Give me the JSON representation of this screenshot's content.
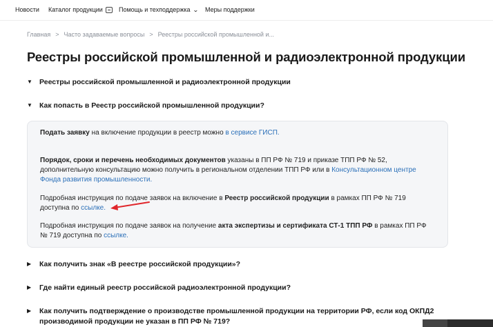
{
  "nav": {
    "news": "Новости",
    "catalog": "Каталог продукции",
    "help": "Помощь и техподдержка",
    "support": "Меры поддержки"
  },
  "breadcrumb": [
    "Главная",
    "Часто задаваемые вопросы",
    "Реестры российской промышленной и..."
  ],
  "page_title": "Реестры российской промышленной и радиоэлектронной продукции",
  "accordion": [
    {
      "q": "Реестры российской промышленной и радиоэлектронной продукции",
      "state": "open"
    },
    {
      "q": "Как попасть в Реестр российской промышленной продукции?",
      "state": "open"
    },
    {
      "q": "Как получить знак «В реестре российской продукции»?",
      "state": "closed"
    },
    {
      "q": "Где найти единый реестр российской радиоэлектронной продукции?",
      "state": "closed"
    },
    {
      "q": "Как получить подтверждение о производстве промышленной продукции на территории РФ, если код ОКПД2 производимой продукции не указан в ПП РФ № 719?",
      "state": "closed"
    }
  ],
  "answer": {
    "p1_bold": "Подать заявку",
    "p1_text": " на включение продукции в реестр можно ",
    "p1_link": "в сервисе ГИСП.",
    "p2_bold": "Порядок, сроки и перечень необходимых документов",
    "p2_text": " указаны в ПП РФ № 719 и приказе ТПП РФ № 52, дополнительную консультацию можно получить в региональном отделении ТПП РФ или в ",
    "p2_link": "Консультационном центре Фонда развития промышленности.",
    "p3_text1": "Подробная инструкция по подаче заявок на включение в ",
    "p3_bold": "Реестр российской продукции",
    "p3_text2": " в рамках ПП РФ № 719 доступна по ",
    "p3_link": "ссылке.",
    "p4_text1": "Подробная инструкция по подаче заявок на получение ",
    "p4_bold": "акта экспертизы и сертификата СТ-1 ТПП РФ",
    "p4_text2": " в рамках ПП РФ № 719 доступна по ",
    "p4_link": "ссылке."
  },
  "colors": {
    "link": "#2a6fb8",
    "annotation_arrow": "#e0262b",
    "panel_bg": "#f5f6f8"
  }
}
